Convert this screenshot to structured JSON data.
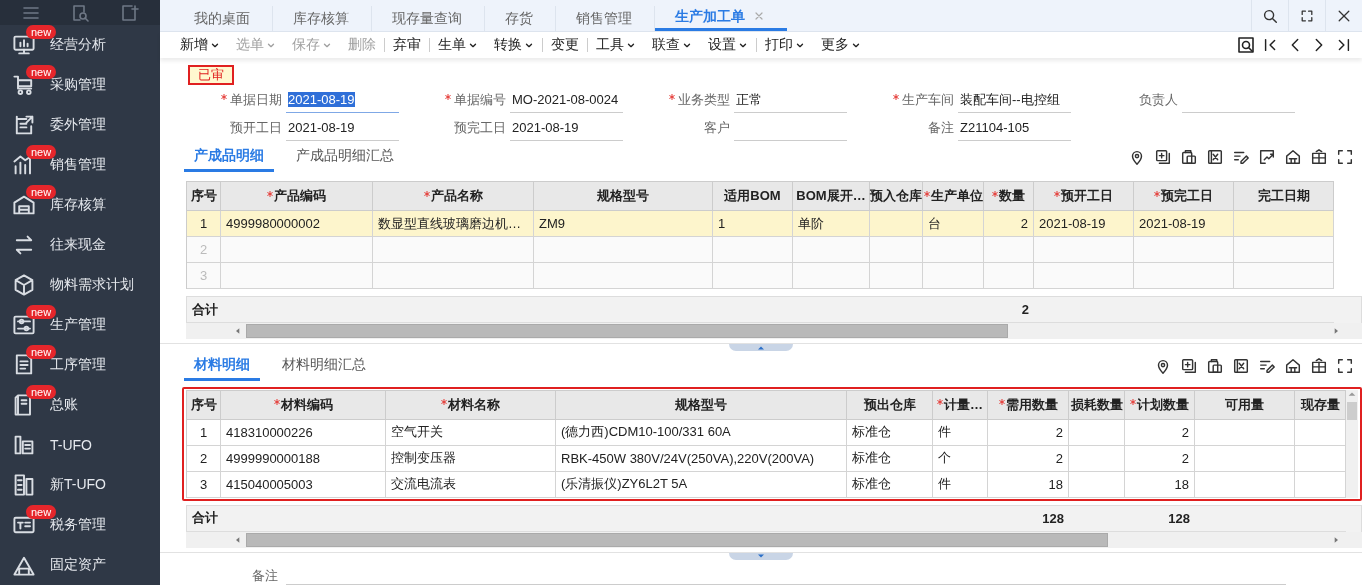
{
  "sidebar": {
    "items": [
      {
        "label": "经营分析",
        "badge": "new"
      },
      {
        "label": "采购管理",
        "badge": "new"
      },
      {
        "label": "委外管理"
      },
      {
        "label": "销售管理",
        "badge": "new"
      },
      {
        "label": "库存核算",
        "badge": "new"
      },
      {
        "label": "往来现金"
      },
      {
        "label": "物料需求计划"
      },
      {
        "label": "生产管理",
        "badge": "new"
      },
      {
        "label": "工序管理",
        "badge": "new"
      },
      {
        "label": "总账",
        "badge": "new"
      },
      {
        "label": "T-UFO"
      },
      {
        "label": "新T-UFO"
      },
      {
        "label": "税务管理",
        "badge": "new"
      },
      {
        "label": "固定资产"
      }
    ]
  },
  "tabs": [
    {
      "label": "我的桌面",
      "selected": false,
      "closable": false
    },
    {
      "label": "库存核算",
      "selected": false,
      "closable": false
    },
    {
      "label": "现存量查询",
      "selected": false,
      "closable": false
    },
    {
      "label": "存货",
      "selected": false,
      "closable": false
    },
    {
      "label": "销售管理",
      "selected": false,
      "closable": false
    },
    {
      "label": "生产加工单",
      "selected": true,
      "closable": true
    }
  ],
  "toolbar": [
    {
      "kind": "button",
      "label": "新增",
      "dropdown": true,
      "disabled": false
    },
    {
      "kind": "button",
      "label": "选单",
      "dropdown": true,
      "disabled": true
    },
    {
      "kind": "button",
      "label": "保存",
      "dropdown": true,
      "disabled": true
    },
    {
      "kind": "button",
      "label": "删除",
      "dropdown": false,
      "disabled": true
    },
    {
      "kind": "separator"
    },
    {
      "kind": "button",
      "label": "弃审",
      "dropdown": false,
      "disabled": false
    },
    {
      "kind": "separator"
    },
    {
      "kind": "button",
      "label": "生单",
      "dropdown": true,
      "disabled": false
    },
    {
      "kind": "button",
      "label": "转换",
      "dropdown": true,
      "disabled": false
    },
    {
      "kind": "separator"
    },
    {
      "kind": "button",
      "label": "变更",
      "dropdown": false,
      "disabled": false
    },
    {
      "kind": "separator"
    },
    {
      "kind": "button",
      "label": "工具",
      "dropdown": true,
      "disabled": false
    },
    {
      "kind": "button",
      "label": "联查",
      "dropdown": true,
      "disabled": false
    },
    {
      "kind": "button",
      "label": "设置",
      "dropdown": true,
      "disabled": false
    },
    {
      "kind": "separator"
    },
    {
      "kind": "button",
      "label": "打印",
      "dropdown": true,
      "disabled": false
    },
    {
      "kind": "button",
      "label": "更多",
      "dropdown": true,
      "disabled": false
    }
  ],
  "status": "已审",
  "form": {
    "rows": [
      [
        {
          "label": "单据日期",
          "value": "2021-08-19",
          "required": true,
          "selected": true
        },
        {
          "label": "单据编号",
          "value": "MO-2021-08-0024",
          "required": true,
          "selected": false
        },
        {
          "label": "业务类型",
          "value": "正常",
          "required": true,
          "selected": false
        },
        {
          "label": "生产车间",
          "value": "装配车间--电控组",
          "required": true,
          "selected": false
        },
        {
          "label": "负责人",
          "required": false,
          "selected": false
        }
      ],
      [
        {
          "label": "预开工日",
          "value": "2021-08-19",
          "required": false,
          "selected": false
        },
        {
          "label": "预完工日",
          "value": "2021-08-19",
          "required": false,
          "selected": false
        },
        {
          "label": "客户",
          "required": false,
          "selected": false
        },
        {
          "label": "备注",
          "value": "Z21104-105",
          "required": false,
          "selected": false
        }
      ]
    ]
  },
  "sections": [
    {
      "tabs": [
        {
          "label": "产成品明细",
          "selected": true
        },
        {
          "label": "产成品明细汇总",
          "selected": false
        }
      ],
      "highlighted": false,
      "table": {
        "columns": [
          {
            "label": "序号",
            "required": false,
            "kind": "index"
          },
          {
            "label": "产品编码",
            "required": true,
            "kind": "text"
          },
          {
            "label": "产品名称",
            "required": true,
            "kind": "text"
          },
          {
            "label": "规格型号",
            "required": false,
            "kind": "text"
          },
          {
            "label": "适用BOM",
            "required": false,
            "kind": "text"
          },
          {
            "label": "BOM展开…",
            "required": false,
            "kind": "text"
          },
          {
            "label": "预入仓库",
            "required": false,
            "kind": "text"
          },
          {
            "label": "生产单位",
            "required": true,
            "kind": "text"
          },
          {
            "label": "数量",
            "required": true,
            "kind": "number",
            "total": "2"
          },
          {
            "label": "预开工日",
            "required": true,
            "kind": "text"
          },
          {
            "label": "预完工日",
            "required": true,
            "kind": "text"
          },
          {
            "label": "完工日期",
            "required": false,
            "kind": "text"
          }
        ],
        "rows": [
          {
            "kind": "data",
            "selected": true,
            "cells": [
              {
                "text": "1"
              },
              {
                "text": "4999980000002"
              },
              {
                "text": "数显型直线玻璃磨边机…"
              },
              {
                "text": "ZM9"
              },
              {
                "text": "1"
              },
              {
                "text": "单阶"
              },
              {},
              {
                "text": "台"
              },
              {
                "text": "2"
              },
              {
                "text": "2021-08-19"
              },
              {
                "text": "2021-08-19"
              },
              {}
            ]
          },
          {
            "kind": "blank",
            "selected": false,
            "cells": [
              {
                "text": "2"
              }
            ]
          },
          {
            "kind": "blank",
            "selected": false,
            "cells": [
              {
                "text": "3"
              }
            ]
          }
        ],
        "total_label": "合计"
      }
    },
    {
      "tabs": [
        {
          "label": "材料明细",
          "selected": true
        },
        {
          "label": "材料明细汇总",
          "selected": false
        }
      ],
      "highlighted": true,
      "table": {
        "columns": [
          {
            "label": "序号",
            "required": false,
            "kind": "index"
          },
          {
            "label": "材料编码",
            "required": true,
            "kind": "text"
          },
          {
            "label": "材料名称",
            "required": true,
            "kind": "text"
          },
          {
            "label": "规格型号",
            "required": false,
            "kind": "text"
          },
          {
            "label": "预出仓库",
            "required": false,
            "kind": "text"
          },
          {
            "label": "计量…",
            "required": true,
            "kind": "text"
          },
          {
            "label": "需用数量",
            "required": true,
            "kind": "number",
            "total": "128"
          },
          {
            "label": "损耗数量",
            "required": false,
            "kind": "number"
          },
          {
            "label": "计划数量",
            "required": true,
            "kind": "number",
            "total": "128"
          },
          {
            "label": "可用量",
            "required": false,
            "kind": "number"
          },
          {
            "label": "现存量",
            "required": false,
            "kind": "number"
          }
        ],
        "rows": [
          {
            "kind": "data",
            "selected": false,
            "cells": [
              {
                "text": "1"
              },
              {
                "text": "418310000226"
              },
              {
                "text": "空气开关"
              },
              {
                "text": "(德力西)CDM10-100/331 60A"
              },
              {
                "text": "标准仓"
              },
              {
                "text": "件"
              },
              {
                "text": "2"
              },
              {},
              {
                "text": "2"
              },
              {},
              {}
            ]
          },
          {
            "kind": "data",
            "selected": false,
            "cells": [
              {
                "text": "2"
              },
              {
                "text": "4999990000188"
              },
              {
                "text": "控制变压器"
              },
              {
                "text": "RBK-450W 380V/24V(250VA),220V(200VA)"
              },
              {
                "text": "标准仓"
              },
              {
                "text": "个"
              },
              {
                "text": "2"
              },
              {},
              {
                "text": "2"
              },
              {},
              {}
            ]
          },
          {
            "kind": "data",
            "selected": false,
            "cells": [
              {
                "text": "3"
              },
              {
                "text": "415040005003"
              },
              {
                "text": "交流电流表"
              },
              {
                "text": "(乐清振仪)ZY6L2T 5A"
              },
              {
                "text": "标准仓"
              },
              {
                "text": "件"
              },
              {
                "text": "18"
              },
              {},
              {
                "text": "18"
              },
              {},
              {}
            ]
          }
        ],
        "total_label": "合计"
      }
    }
  ],
  "remark": {
    "label": "备注"
  }
}
